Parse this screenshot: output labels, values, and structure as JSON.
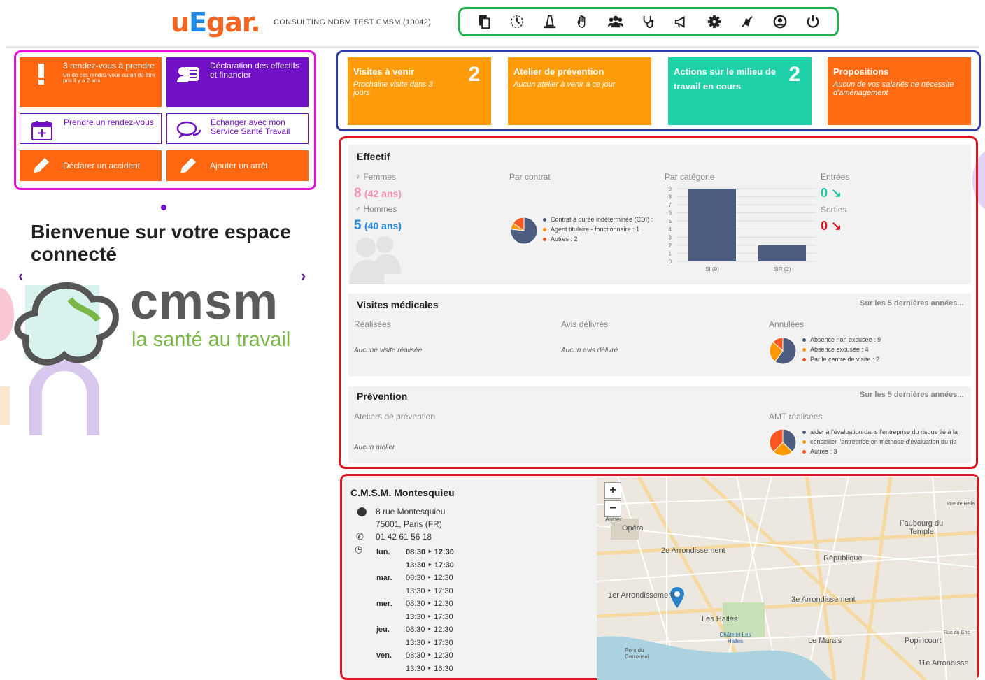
{
  "header": {
    "logo": {
      "part1": "u",
      "part2": "E",
      "part3": "gar."
    },
    "org_name": "CONSULTING NDBM TEST CMSM (10042)",
    "toolbar_icons": [
      "documents-icon",
      "history-icon",
      "workplace-icon",
      "hand-icon",
      "employees-icon",
      "stethoscope-icon",
      "megaphone-icon",
      "settings-icon",
      "mute-icon",
      "account-icon",
      "power-icon"
    ]
  },
  "actions": {
    "rdv_title": "3 rendez-vous à prendre",
    "rdv_sub": "Un de ces rendez-vous aurait dû être pris il y a 2 ans",
    "declaration": "Déclaration des effectifs et financier",
    "prendre_rdv": "Prendre un rendez-vous",
    "echanger": "Echanger avec mon Service Santé Travail",
    "accident": "Déclarer un accident",
    "arret": "Ajouter un arrêt"
  },
  "welcome": {
    "title": "Bienvenue sur votre espace connecté",
    "brand": "cmsm",
    "tagline": "la santé au travail"
  },
  "kpis": [
    {
      "title": "Visites à venir",
      "sub": "Prochaine visite dans 3 jours",
      "count": "2",
      "color": "#ff9c0b"
    },
    {
      "title": "Atelier de prévention",
      "sub": "Aucun atelier à venir à ce jour",
      "count": "",
      "color": "#ff9c0b"
    },
    {
      "title": "Actions sur le milieu de travail en cours",
      "sub": "",
      "count": "2",
      "color": "#20d2a9"
    },
    {
      "title": "Propositions",
      "sub": "Aucun de vos salariés ne nécessite d'aménagement",
      "count": "",
      "color": "#ff6b12"
    }
  ],
  "effectif": {
    "title": "Effectif",
    "femmes_label": "Femmes",
    "femmes_count": "8",
    "femmes_age": "(42 ans)",
    "hommes_label": "Hommes",
    "hommes_count": "5",
    "hommes_age": "(40 ans)",
    "contrat_label": "Par contrat",
    "categorie_label": "Par catégorie",
    "entrees_label": "Entrées",
    "entrees_value": "0",
    "sorties_label": "Sorties",
    "sorties_value": "0"
  },
  "visites": {
    "title": "Visites médicales",
    "link": "Sur les 5 dernières années...",
    "realisees_label": "Réalisées",
    "realisees_note": "Aucune visite réalisée",
    "avis_label": "Avis délivrés",
    "avis_note": "Aucun avis délivré",
    "annulees_label": "Annulées"
  },
  "prevention": {
    "title": "Prévention",
    "link": "Sur les 5 dernières années...",
    "ateliers_label": "Ateliers de prévention",
    "ateliers_note": "Aucun atelier",
    "amt_label": "AMT réalisées"
  },
  "chart_data": [
    {
      "type": "pie",
      "title": "",
      "labels": [
        "Contrat à durée indéterminée (CDI) :",
        "Agent titulaire - fonctionnaire : 1",
        "Autres : 2"
      ],
      "values": [
        10,
        1,
        2
      ],
      "colors": [
        "#4b5c7e",
        "#ff9800",
        "#ff5722"
      ]
    },
    {
      "type": "bar",
      "title": "",
      "categories": [
        "SI (9)",
        "SIR (2)"
      ],
      "values": [
        9,
        2
      ],
      "ylim": [
        0,
        9
      ],
      "yticks": [
        0,
        1,
        2,
        3,
        4,
        5,
        6,
        7,
        8,
        9
      ],
      "grid": true,
      "colors": [
        "#4b5c7e"
      ]
    },
    {
      "type": "pie",
      "title": "",
      "labels": [
        "Absence non excusée : 9",
        "Absence excusée : 4",
        "Par le centre de visite : 2"
      ],
      "values": [
        9,
        4,
        2
      ],
      "colors": [
        "#4b5c7e",
        "#ff9800",
        "#ff5722"
      ]
    },
    {
      "type": "pie",
      "title": "",
      "labels": [
        "aider à l'évaluation dans l'entreprise du risque lié à la",
        "conseiller l'entreprise en méthode d'évaluation du ris",
        "Autres : 3"
      ],
      "values": [
        3,
        2,
        3
      ],
      "colors": [
        "#4b5c7e",
        "#ff9800",
        "#ff5722"
      ]
    }
  ],
  "clinic": {
    "name": "C.M.S.M. Montesquieu",
    "address1": "8 rue Montesquieu",
    "address2": "75001, Paris (FR)",
    "phone": "01 42 61 56 18",
    "hours": [
      {
        "day": "lun.",
        "am": "08:30 ‣ 12:30",
        "pm": "13:30 ‣ 17:30"
      },
      {
        "day": "mar.",
        "am": "08:30 ‣ 12:30",
        "pm": "13:30 ‣ 17:30"
      },
      {
        "day": "mer.",
        "am": "08:30 ‣ 12:30",
        "pm": "13:30 ‣ 17:30"
      },
      {
        "day": "jeu.",
        "am": "08:30 ‣ 12:30",
        "pm": "13:30 ‣ 17:30"
      },
      {
        "day": "ven.",
        "am": "08:30 ‣ 12:30",
        "pm": "13:30 ‣ 16:30"
      }
    ]
  },
  "map": {
    "zoom_in": "+",
    "zoom_out": "−",
    "labels": [
      "Auber",
      "Opéra",
      "2e Arrondissement",
      "République",
      "Faubourg du Temple",
      "1er Arrondissement",
      "3e Arrondissement",
      "Les Halles",
      "Châtelet Les Halles",
      "Le Marais",
      "Popincourt",
      "Rue du Che",
      "11e Arrondisse",
      "Rue de Belle",
      "Pont du Carrousel"
    ]
  }
}
